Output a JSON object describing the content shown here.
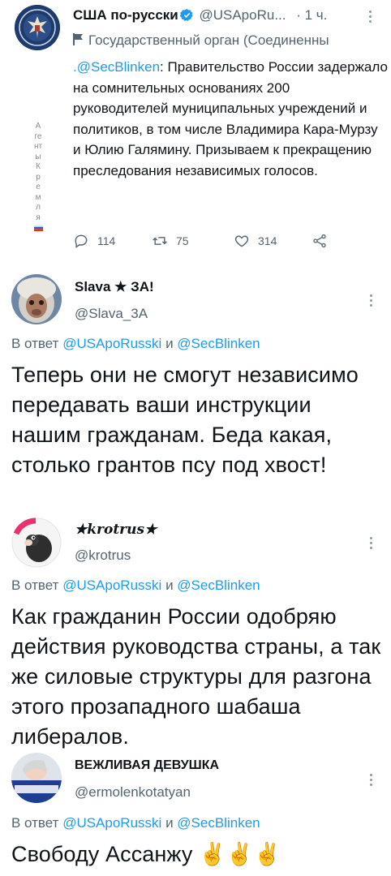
{
  "main_tweet": {
    "author_name": "США по-русски",
    "author_handle": "@USApoRu...",
    "time": "· 1 ч.",
    "government_label": "Государственный орган (Соединенны",
    "mention": ".@SecBlinken",
    "text": ": Правительство России задержало на сомнительных основаниях 200 руководителей муниципальных учреждений и политиков, в том числе Владимира Кара-Мурзу и Юлию Галямину. Призываем к прекращению преследования независимых голосов.",
    "thread_label": [
      "А",
      "ге",
      "нт",
      "ы",
      "К",
      "р",
      "е",
      "м",
      "л",
      "я"
    ],
    "stats": {
      "replies": "114",
      "retweets": "75",
      "likes": "314"
    },
    "icons": [
      "reply-icon",
      "retweet-icon",
      "like-icon",
      "share-icon"
    ]
  },
  "replies": [
    {
      "name": "Slava ★ ЗА!",
      "handle": "@Slava_3A",
      "reply_prefix": "В ответ",
      "reply_mention_1": "@USApoRusski",
      "reply_join": "и",
      "reply_mention_2": "@SecBlinken",
      "text": "Теперь они не смогут независимо передавать ваши инструкции нашим гражданам. Беда какая, столько грантов псу под хвост!"
    },
    {
      "name": "★krotrus★",
      "handle": "@krotrus",
      "reply_prefix": "В ответ",
      "reply_mention_1": "@USApoRusski",
      "reply_join": "и",
      "reply_mention_2": "@SecBlinken",
      "text": "Как гражданин России одобряю действия руководства страны, а так же силовые структуры для разгона этого прозападного шабаша либералов."
    },
    {
      "name": "ВЕЖЛИВАЯ ДЕВУШКА",
      "handle": "@ermolenkotatyan",
      "reply_prefix": "В ответ",
      "reply_mention_1": "@USApoRusski",
      "reply_join": "и",
      "reply_mention_2": "@SecBlinken",
      "text": "Свободу Ассанжу ✌️✌️✌️"
    }
  ],
  "colors": {
    "link": "#1d9bf0",
    "muted": "#536471",
    "verified": "#1d9bf0"
  }
}
